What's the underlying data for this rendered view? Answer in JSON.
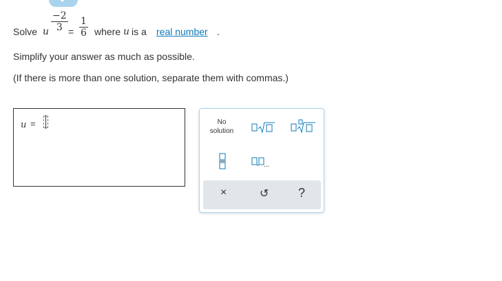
{
  "question": {
    "prefix": "Solve",
    "variable": "u",
    "fraction_left": {
      "numerator": "−2",
      "denominator": "3"
    },
    "equals": "=",
    "fraction_right": {
      "numerator": "1",
      "denominator": "6"
    },
    "middle": "where",
    "var2": "u",
    "middle2": "is a",
    "link_text": "real number",
    "period": "."
  },
  "instruction1": "Simplify your answer as much as possible.",
  "instruction2": "(If there is more than one solution, separate them with commas.)",
  "answer": {
    "variable": "u",
    "equals": "="
  },
  "keypad": {
    "no_solution_line1": "No",
    "no_solution_line2": "solution",
    "list_ellipsis": "...",
    "clear_symbol": "×",
    "undo_symbol": "↺",
    "help_symbol": "?"
  },
  "colors": {
    "accent": "#0e7ab8",
    "tab": "#a9d4ee",
    "toolstrip": "#e1e6ea"
  }
}
